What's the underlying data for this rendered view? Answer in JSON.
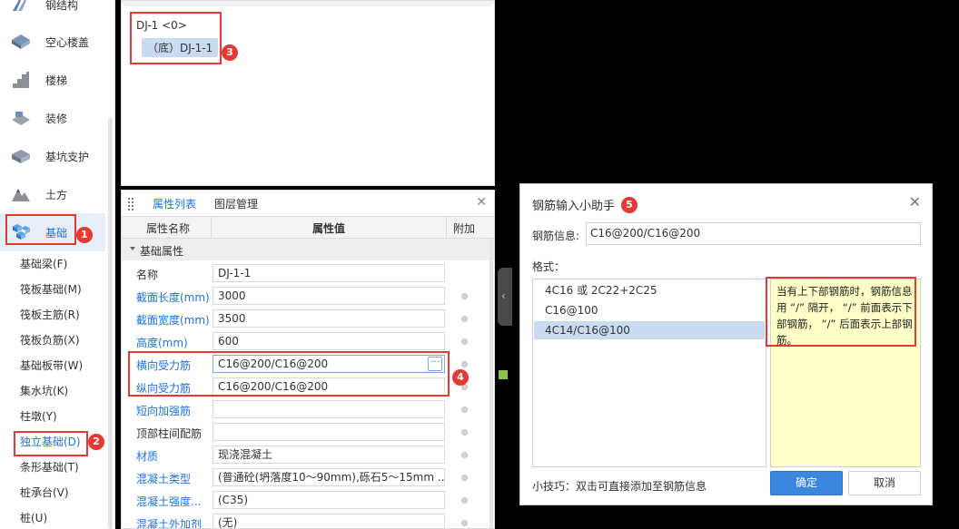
{
  "sidebar": {
    "categories": [
      {
        "label": "钢结构",
        "icon": "steel-structure-icon"
      },
      {
        "label": "空心楼盖",
        "icon": "hollow-floor-icon"
      },
      {
        "label": "楼梯",
        "icon": "stairs-icon"
      },
      {
        "label": "装修",
        "icon": "decoration-icon"
      },
      {
        "label": "基坑支护",
        "icon": "pit-support-icon"
      },
      {
        "label": "土方",
        "icon": "earthwork-icon"
      },
      {
        "label": "基础",
        "icon": "foundation-icon"
      }
    ],
    "subitems": [
      "基础梁(F)",
      "筏板基础(M)",
      "筏板主筋(R)",
      "筏板负筋(X)",
      "基础板带(W)",
      "集水坑(K)",
      "柱墩(Y)",
      "独立基础(D)",
      "条形基础(T)",
      "桩承台(V)",
      "桩(U)"
    ]
  },
  "tree": {
    "root": "DJ-1 <0>",
    "child": "（底）DJ-1-1"
  },
  "properties": {
    "tabs": [
      "属性列表",
      "图层管理"
    ],
    "headers": {
      "name": "属性名称",
      "value": "属性值",
      "extra": "附加"
    },
    "group": "基础属性",
    "rows": [
      {
        "name": "名称",
        "value": "DJ-1-1"
      },
      {
        "name": "截面长度(mm)",
        "value": "3000"
      },
      {
        "name": "截面宽度(mm)",
        "value": "3500"
      },
      {
        "name": "高度(mm)",
        "value": "600"
      },
      {
        "name": "横向受力筋",
        "value": "C16@200/C16@200"
      },
      {
        "name": "纵向受力筋",
        "value": "C16@200/C16@200"
      },
      {
        "name": "短向加强筋",
        "value": ""
      },
      {
        "name": "顶部柱间配筋",
        "value": ""
      },
      {
        "name": "材质",
        "value": "现浇混凝土"
      },
      {
        "name": "混凝土类型",
        "value": "(普通砼(坍落度10～90mm),砾石5～15mm ..."
      },
      {
        "name": "混凝土强度...",
        "value": "(C35)"
      },
      {
        "name": "混凝土外加剂",
        "value": "(无)"
      }
    ]
  },
  "dialog": {
    "title": "钢筋输入小助手",
    "rebar_label": "钢筋信息:",
    "rebar_value": "C16@200/C16@200",
    "format_label": "格式：",
    "formats": [
      "4C16 或 2C22+2C25",
      "C16@100",
      "4C14/C16@100"
    ],
    "tip": "当有上下部钢筋时，钢筋信息用 “/” 隔开， “/” 前面表示下部钢筋， “/” 后面表示上部钢筋。",
    "hint": "小技巧：双击可直接添加至钢筋信息",
    "ok": "确定",
    "cancel": "取消"
  },
  "badges": [
    "1",
    "2",
    "3",
    "4",
    "5"
  ],
  "colors": {
    "accent": "#1a73e8",
    "callout": "#e53935",
    "selected": "#c9dbf2",
    "tip_bg": "#ffffc8"
  }
}
